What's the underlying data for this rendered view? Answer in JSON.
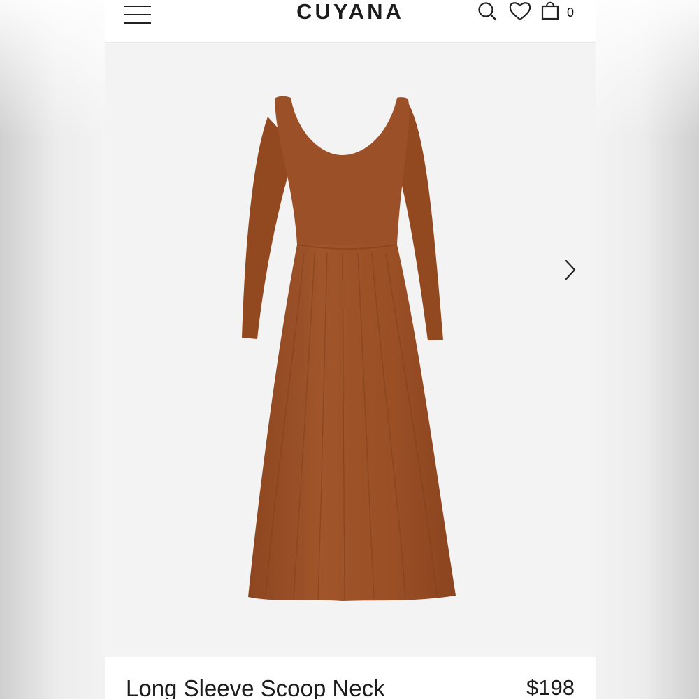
{
  "header": {
    "brand": "CUYANA",
    "menu_icon": "hamburger-menu-icon",
    "search_icon": "search-icon",
    "wishlist_icon": "heart-icon",
    "bag_icon": "shopping-bag-icon",
    "bag_count": "0"
  },
  "gallery": {
    "image": "dress-product-image",
    "next_icon": "chevron-right-icon",
    "dress_color": "#9a4f24"
  },
  "product": {
    "title": "Long Sleeve Scoop Neck",
    "price": "$198"
  }
}
